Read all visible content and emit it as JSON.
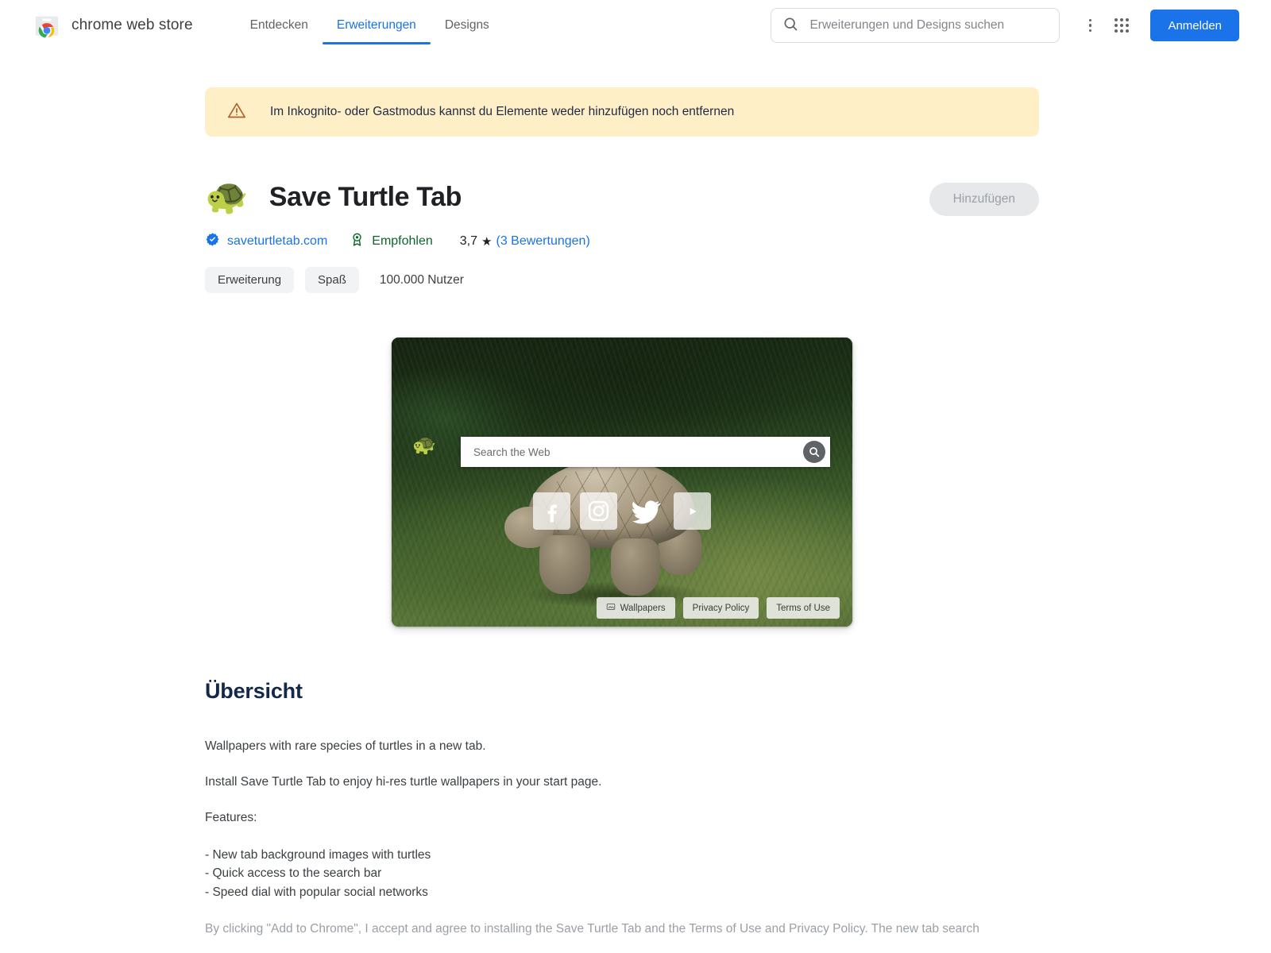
{
  "header": {
    "brand_name": "chrome web store",
    "logo_icon": "chrome-web-store-bag-icon",
    "nav": [
      {
        "label": "Entdecken",
        "active": false,
        "name": "tab-entdecken"
      },
      {
        "label": "Erweiterungen",
        "active": true,
        "name": "tab-erweiterungen"
      },
      {
        "label": "Designs",
        "active": false,
        "name": "tab-designs"
      }
    ],
    "search": {
      "placeholder": "Erweiterungen und Designs suchen",
      "value": "",
      "icon": "search-icon"
    },
    "more_icon": "more-vertical-icon",
    "apps_icon": "google-apps-grid-icon",
    "signin_label": "Anmelden"
  },
  "banner": {
    "icon": "warning-triangle-icon",
    "text": "Im Inkognito- oder Gastmodus kannst du Elemente weder hinzufügen noch entfernen"
  },
  "listing": {
    "icon": "turtle-emoji-icon",
    "icon_glyph": "🐢",
    "title": "Save Turtle Tab",
    "add_button_label": "Hinzufügen",
    "add_button_disabled": true,
    "website": "saveturtletab.com",
    "website_icon": "verified-badge-icon",
    "featured_label": "Empfohlen",
    "featured_icon": "award-ribbon-icon",
    "rating_value": "3,7",
    "rating_star": "★",
    "reviews_label": "(3 Bewertungen)",
    "tags": [
      "Erweiterung",
      "Spaß"
    ],
    "users": "100.000 Nutzer"
  },
  "preview": {
    "search_placeholder": "Search the Web",
    "search_icon": "search-icon",
    "turtle_glyph": "🐢",
    "socials": [
      {
        "name": "facebook-icon",
        "label": "Facebook"
      },
      {
        "name": "instagram-icon",
        "label": "Instagram"
      },
      {
        "name": "twitter-icon",
        "label": "Twitter"
      },
      {
        "name": "youtube-icon",
        "label": "YouTube"
      }
    ],
    "footer_buttons": [
      {
        "label": "Wallpapers",
        "icon": "wallpaper-icon"
      },
      {
        "label": "Privacy Policy",
        "icon": ""
      },
      {
        "label": "Terms of Use",
        "icon": ""
      }
    ]
  },
  "overview": {
    "heading": "Übersicht",
    "paragraph1": "Wallpapers with rare species of turtles in a new tab.",
    "paragraph2": "Install Save Turtle Tab to enjoy hi-res turtle wallpapers in your start page.",
    "features_heading": "Features:",
    "features": [
      "- New tab background images with turtles",
      "- Quick access to the search bar",
      "- Speed dial with popular social networks"
    ],
    "disclaimer": "By clicking \"Add to Chrome\", I accept and agree to installing the Save Turtle Tab and the Terms of Use and Privacy Policy. The new tab search"
  },
  "colors": {
    "accent_blue": "#1a73e8",
    "banner_bg": "#feefc7",
    "featured_green": "#0d652d",
    "heading_navy": "#13284b",
    "tag_bg": "#f1f3f4",
    "disabled_btn_bg": "#e7e8ea"
  }
}
